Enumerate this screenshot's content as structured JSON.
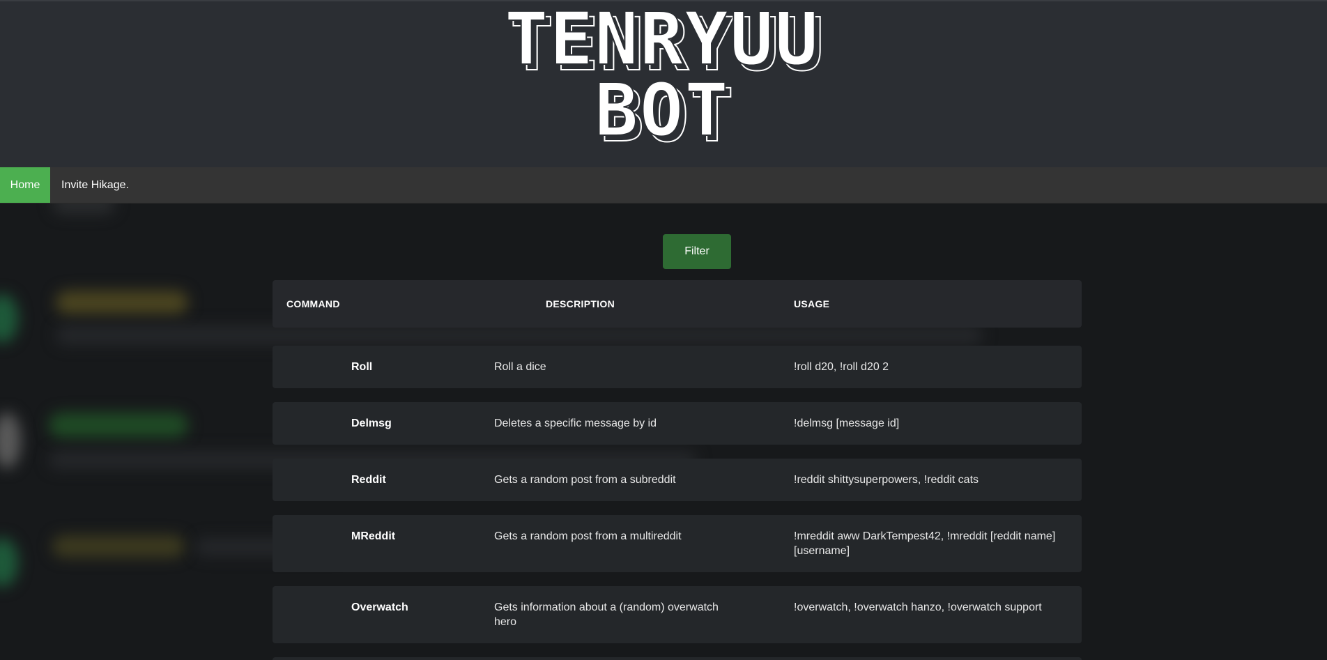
{
  "logo": {
    "line1": "TENRYUU",
    "line2": "BOT"
  },
  "nav": {
    "home": "Home",
    "invite": "Invite Hikage."
  },
  "filter_label": "Filter",
  "table": {
    "headers": {
      "command": "COMMAND",
      "description": "DESCRIPTION",
      "usage": "USAGE"
    },
    "rows": [
      {
        "name": "Roll",
        "description": "Roll a dice",
        "usage": "!roll d20, !roll d20 2"
      },
      {
        "name": "Delmsg",
        "description": "Deletes a specific message by id",
        "usage": "!delmsg [message id]"
      },
      {
        "name": "Reddit",
        "description": "Gets a random post from a subreddit",
        "usage": "!reddit shittysuperpowers, !reddit cats"
      },
      {
        "name": "MReddit",
        "description": "Gets a random post from a multireddit",
        "usage": "!mreddit aww DarkTempest42, !mreddit [reddit name] [username]"
      },
      {
        "name": "Overwatch",
        "description": "Gets information about a (random) overwatch hero",
        "usage": "!overwatch, !overwatch hanzo, !overwatch support"
      }
    ]
  },
  "colors": {
    "header_bg": "#2b2e33",
    "nav_bg": "#343434",
    "home_active": "#4caf50",
    "filter_button": "#2e6b33",
    "page_bg": "#17191b",
    "row_bg": "#24272a"
  }
}
